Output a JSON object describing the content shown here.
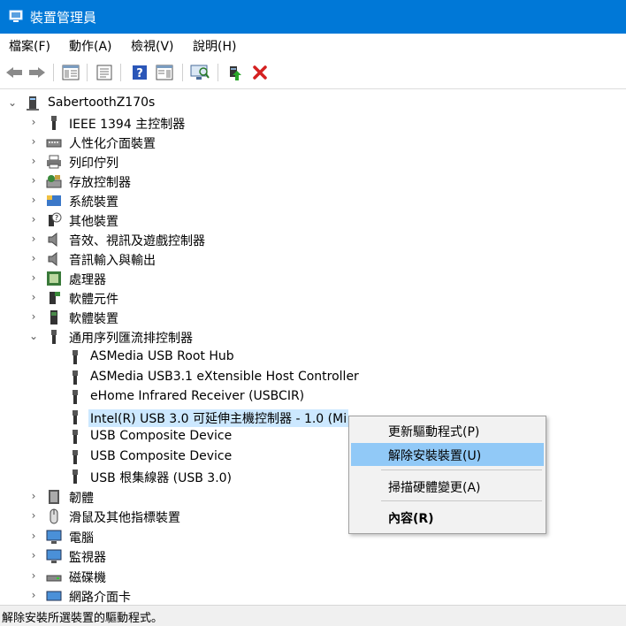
{
  "window": {
    "title": "裝置管理員",
    "accent": "#0078d7"
  },
  "menubar": {
    "items": [
      "檔案(F)",
      "動作(A)",
      "檢視(V)",
      "說明(H)"
    ]
  },
  "toolbar": {
    "icons": [
      "back-arrow-icon",
      "forward-arrow-icon",
      "show-hide-console-tree-icon",
      "properties-icon",
      "help-icon",
      "action-pane-icon",
      "scan-hardware-icon",
      "update-driver-icon",
      "uninstall-device-icon"
    ]
  },
  "tree": {
    "root": "SabertoothZ170s",
    "categories": [
      {
        "label": "IEEE 1394 主控制器",
        "icon": "ieee1394-icon"
      },
      {
        "label": "人性化介面裝置",
        "icon": "hid-icon"
      },
      {
        "label": "列印佇列",
        "icon": "printer-icon"
      },
      {
        "label": "存放控制器",
        "icon": "storage-controller-icon"
      },
      {
        "label": "系統裝置",
        "icon": "system-device-icon"
      },
      {
        "label": "其他裝置",
        "icon": "unknown-device-icon"
      },
      {
        "label": "音效、視訊及遊戲控制器",
        "icon": "speaker-icon"
      },
      {
        "label": "音訊輸入與輸出",
        "icon": "speaker-icon"
      },
      {
        "label": "處理器",
        "icon": "processor-icon"
      },
      {
        "label": "軟體元件",
        "icon": "software-component-icon"
      },
      {
        "label": "軟體裝置",
        "icon": "software-device-icon"
      },
      {
        "label": "通用序列匯流排控制器",
        "icon": "usb-icon"
      }
    ],
    "usb_children": [
      "ASMedia USB Root Hub",
      "ASMedia USB3.1 eXtensible Host Controller",
      "eHome Infrared Receiver (USBCIR)",
      "Intel(R) USB 3.0 可延伸主機控制器 - 1.0 (Mi",
      "USB Composite Device",
      "USB Composite Device",
      "USB 根集線器 (USB 3.0)"
    ],
    "after": [
      {
        "label": "韌體",
        "icon": "firmware-icon"
      },
      {
        "label": "滑鼠及其他指標裝置",
        "icon": "mouse-icon"
      },
      {
        "label": "電腦",
        "icon": "computer-icon"
      },
      {
        "label": "監視器",
        "icon": "monitor-icon"
      },
      {
        "label": "磁碟機",
        "icon": "disk-drive-icon"
      },
      {
        "label": "網路介面卡",
        "icon": "network-adapter-icon"
      }
    ]
  },
  "context_menu": {
    "update_driver": "更新驅動程式(P)",
    "uninstall_device": "解除安裝裝置(U)",
    "scan_hardware": "掃描硬體變更(A)",
    "properties": "內容(R)"
  },
  "statusbar": {
    "text": "解除安裝所選裝置的驅動程式。"
  }
}
